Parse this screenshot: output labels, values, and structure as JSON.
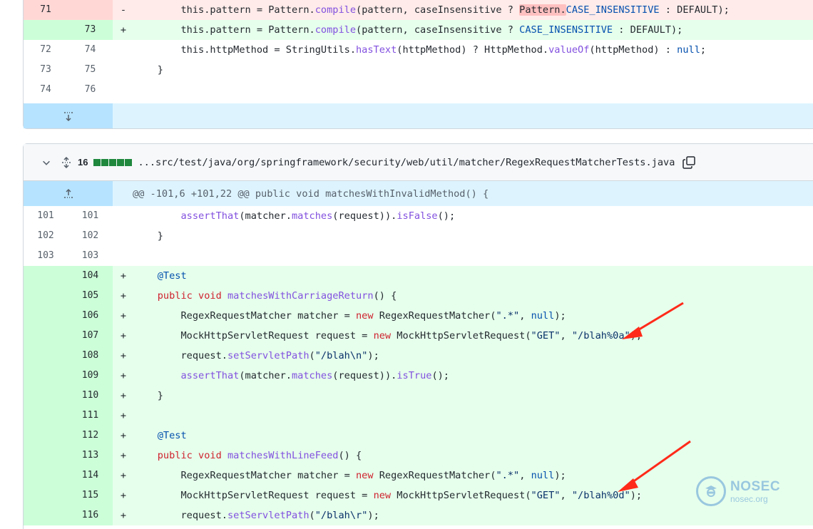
{
  "block1": {
    "rows": [
      {
        "type": "del",
        "old": "71",
        "new": "",
        "marker": "-",
        "tokens": [
          {
            "t": "        this.pattern = Pattern.",
            "c": ""
          },
          {
            "t": "compile",
            "c": "fn"
          },
          {
            "t": "(pattern, caseInsensitive ? ",
            "c": ""
          },
          {
            "t": "Pattern.",
            "c": "word-del"
          },
          {
            "t": "CASE_INSENSITIVE",
            "c": "const"
          },
          {
            "t": " : DEFAULT);",
            "c": ""
          }
        ]
      },
      {
        "type": "add",
        "old": "",
        "new": "73",
        "marker": "+",
        "tokens": [
          {
            "t": "        this.pattern = Pattern.",
            "c": ""
          },
          {
            "t": "compile",
            "c": "fn"
          },
          {
            "t": "(pattern, caseInsensitive ? ",
            "c": ""
          },
          {
            "t": "CASE_INSENSITIVE",
            "c": "const"
          },
          {
            "t": " : DEFAULT);",
            "c": ""
          }
        ]
      },
      {
        "type": "ctx",
        "old": "72",
        "new": "74",
        "marker": "",
        "tokens": [
          {
            "t": "        this.httpMethod = StringUtils.",
            "c": ""
          },
          {
            "t": "hasText",
            "c": "fn"
          },
          {
            "t": "(httpMethod) ? HttpMethod.",
            "c": ""
          },
          {
            "t": "valueOf",
            "c": "fn"
          },
          {
            "t": "(httpMethod) : ",
            "c": ""
          },
          {
            "t": "null",
            "c": "const"
          },
          {
            "t": ";",
            "c": ""
          }
        ]
      },
      {
        "type": "ctx",
        "old": "73",
        "new": "75",
        "marker": "",
        "tokens": [
          {
            "t": "    }",
            "c": ""
          }
        ]
      },
      {
        "type": "ctx",
        "old": "74",
        "new": "76",
        "marker": "",
        "tokens": []
      }
    ]
  },
  "file_header": {
    "changes_count": "16",
    "file_path": "...src/test/java/org/springframework/security/web/util/matcher/RegexRequestMatcherTests.java",
    "diffstat_blocks": 5
  },
  "block2": {
    "hunk": "@@ -101,6 +101,22 @@ public void matchesWithInvalidMethod() {",
    "rows": [
      {
        "type": "ctx",
        "old": "101",
        "new": "101",
        "marker": "",
        "tokens": [
          {
            "t": "        ",
            "c": ""
          },
          {
            "t": "assertThat",
            "c": "fn"
          },
          {
            "t": "(matcher.",
            "c": ""
          },
          {
            "t": "matches",
            "c": "fn"
          },
          {
            "t": "(request)).",
            "c": ""
          },
          {
            "t": "isFalse",
            "c": "fn"
          },
          {
            "t": "();",
            "c": ""
          }
        ]
      },
      {
        "type": "ctx",
        "old": "102",
        "new": "102",
        "marker": "",
        "tokens": [
          {
            "t": "    }",
            "c": ""
          }
        ]
      },
      {
        "type": "ctx",
        "old": "103",
        "new": "103",
        "marker": "",
        "tokens": []
      },
      {
        "type": "add",
        "old": "",
        "new": "104",
        "marker": "+",
        "tokens": [
          {
            "t": "    ",
            "c": ""
          },
          {
            "t": "@Test",
            "c": "const"
          }
        ]
      },
      {
        "type": "add",
        "old": "",
        "new": "105",
        "marker": "+",
        "tokens": [
          {
            "t": "    ",
            "c": ""
          },
          {
            "t": "public",
            "c": "kw"
          },
          {
            "t": " ",
            "c": ""
          },
          {
            "t": "void",
            "c": "kw"
          },
          {
            "t": " ",
            "c": ""
          },
          {
            "t": "matchesWithCarriageReturn",
            "c": "fn"
          },
          {
            "t": "() {",
            "c": ""
          }
        ]
      },
      {
        "type": "add",
        "old": "",
        "new": "106",
        "marker": "+",
        "tokens": [
          {
            "t": "        RegexRequestMatcher matcher = ",
            "c": ""
          },
          {
            "t": "new",
            "c": "kw"
          },
          {
            "t": " RegexRequestMatcher(",
            "c": ""
          },
          {
            "t": "\".*\"",
            "c": "str"
          },
          {
            "t": ", ",
            "c": ""
          },
          {
            "t": "null",
            "c": "const"
          },
          {
            "t": ");",
            "c": ""
          }
        ]
      },
      {
        "type": "add",
        "old": "",
        "new": "107",
        "marker": "+",
        "tokens": [
          {
            "t": "        MockHttpServletRequest request = ",
            "c": ""
          },
          {
            "t": "new",
            "c": "kw"
          },
          {
            "t": " MockHttpServletRequest(",
            "c": ""
          },
          {
            "t": "\"GET\"",
            "c": "str"
          },
          {
            "t": ", ",
            "c": ""
          },
          {
            "t": "\"/blah%0a\"",
            "c": "str"
          },
          {
            "t": ");",
            "c": ""
          }
        ]
      },
      {
        "type": "add",
        "old": "",
        "new": "108",
        "marker": "+",
        "tokens": [
          {
            "t": "        request.",
            "c": ""
          },
          {
            "t": "setServletPath",
            "c": "fn"
          },
          {
            "t": "(",
            "c": ""
          },
          {
            "t": "\"/blah\\n\"",
            "c": "str"
          },
          {
            "t": ");",
            "c": ""
          }
        ]
      },
      {
        "type": "add",
        "old": "",
        "new": "109",
        "marker": "+",
        "tokens": [
          {
            "t": "        ",
            "c": ""
          },
          {
            "t": "assertThat",
            "c": "fn"
          },
          {
            "t": "(matcher.",
            "c": ""
          },
          {
            "t": "matches",
            "c": "fn"
          },
          {
            "t": "(request)).",
            "c": ""
          },
          {
            "t": "isTrue",
            "c": "fn"
          },
          {
            "t": "();",
            "c": ""
          }
        ]
      },
      {
        "type": "add",
        "old": "",
        "new": "110",
        "marker": "+",
        "tokens": [
          {
            "t": "    }",
            "c": ""
          }
        ]
      },
      {
        "type": "add",
        "old": "",
        "new": "111",
        "marker": "+",
        "tokens": []
      },
      {
        "type": "add",
        "old": "",
        "new": "112",
        "marker": "+",
        "tokens": [
          {
            "t": "    ",
            "c": ""
          },
          {
            "t": "@Test",
            "c": "const"
          }
        ]
      },
      {
        "type": "add",
        "old": "",
        "new": "113",
        "marker": "+",
        "tokens": [
          {
            "t": "    ",
            "c": ""
          },
          {
            "t": "public",
            "c": "kw"
          },
          {
            "t": " ",
            "c": ""
          },
          {
            "t": "void",
            "c": "kw"
          },
          {
            "t": " ",
            "c": ""
          },
          {
            "t": "matchesWithLineFeed",
            "c": "fn"
          },
          {
            "t": "() {",
            "c": ""
          }
        ]
      },
      {
        "type": "add",
        "old": "",
        "new": "114",
        "marker": "+",
        "tokens": [
          {
            "t": "        RegexRequestMatcher matcher = ",
            "c": ""
          },
          {
            "t": "new",
            "c": "kw"
          },
          {
            "t": " RegexRequestMatcher(",
            "c": ""
          },
          {
            "t": "\".*\"",
            "c": "str"
          },
          {
            "t": ", ",
            "c": ""
          },
          {
            "t": "null",
            "c": "const"
          },
          {
            "t": ");",
            "c": ""
          }
        ]
      },
      {
        "type": "add",
        "old": "",
        "new": "115",
        "marker": "+",
        "tokens": [
          {
            "t": "        MockHttpServletRequest request = ",
            "c": ""
          },
          {
            "t": "new",
            "c": "kw"
          },
          {
            "t": " MockHttpServletRequest(",
            "c": ""
          },
          {
            "t": "\"GET\"",
            "c": "str"
          },
          {
            "t": ", ",
            "c": ""
          },
          {
            "t": "\"/blah%0d\"",
            "c": "str"
          },
          {
            "t": ");",
            "c": ""
          }
        ]
      },
      {
        "type": "add",
        "old": "",
        "new": "116",
        "marker": "+",
        "tokens": [
          {
            "t": "        request.",
            "c": ""
          },
          {
            "t": "setServletPath",
            "c": "fn"
          },
          {
            "t": "(",
            "c": ""
          },
          {
            "t": "\"/blah\\r\"",
            "c": "str"
          },
          {
            "t": ");",
            "c": ""
          }
        ]
      }
    ]
  },
  "watermark": {
    "title": "NOSEC",
    "subtitle": "nosec.org"
  },
  "colors": {
    "annotation_arrow": "#ff2a1a",
    "add_bg": "#e6ffec",
    "del_bg": "#ffebe9",
    "hunk_bg": "#ddf4ff"
  }
}
